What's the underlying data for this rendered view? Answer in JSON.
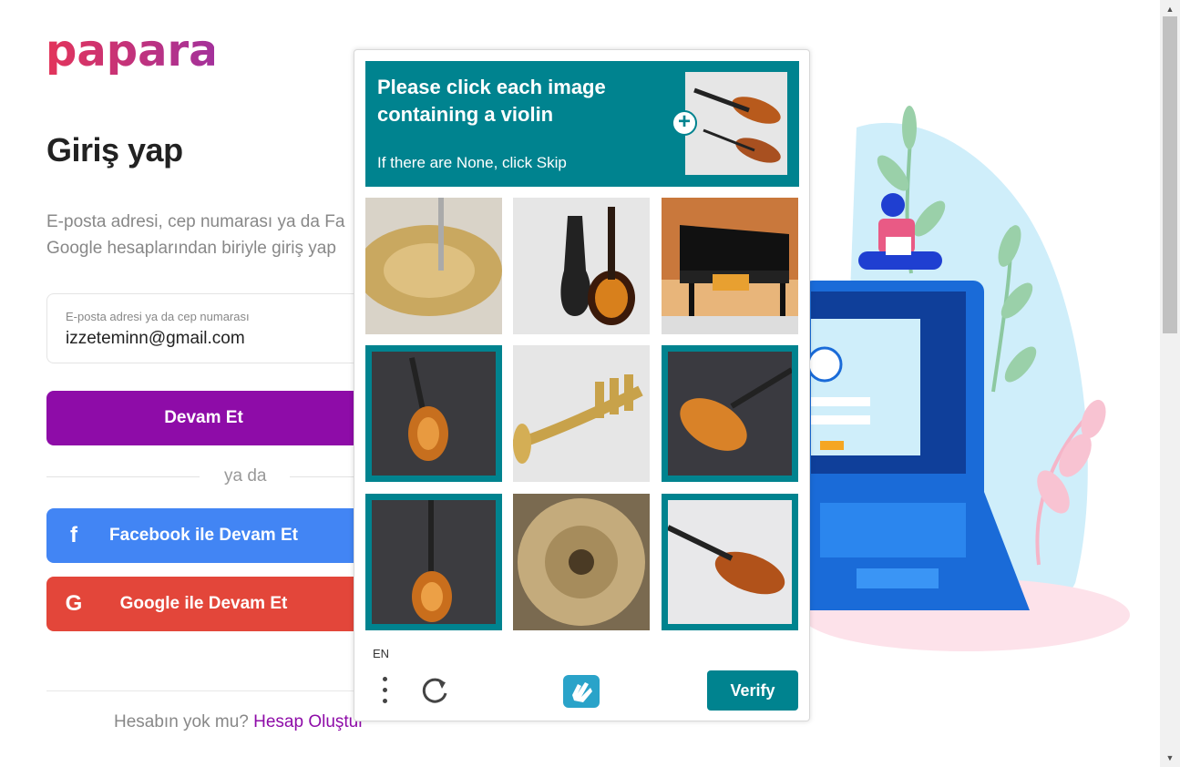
{
  "brand": {
    "name": "papara",
    "color": "#8e0ca8",
    "accent": "#e3345a"
  },
  "login": {
    "title": "Giriş yap",
    "description_line1": "E-posta adresi, cep numarası ya da Fa",
    "description_line2": "Google hesaplarından biriyle giriş yap",
    "email_label": "E-posta adresi ya da cep numarası",
    "email_value": "izzeteminn@gmail.com",
    "continue_label": "Devam Et",
    "or_label": "ya da",
    "facebook_label": "Facebook ile Devam Et",
    "google_label": "Google ile Devam Et",
    "no_account_text": "Hesabın yok mu?",
    "create_account_link": "Hesap Oluştur"
  },
  "captcha": {
    "prompt": "Please click each image containing a violin",
    "sub_prompt": "If there are None, click Skip",
    "language": "EN",
    "verify_label": "Verify",
    "accent": "#00838f",
    "tiles": [
      {
        "subject": "cymbal",
        "selected": false
      },
      {
        "subject": "guitars",
        "selected": false
      },
      {
        "subject": "piano",
        "selected": false
      },
      {
        "subject": "violin",
        "selected": true
      },
      {
        "subject": "trumpet",
        "selected": false
      },
      {
        "subject": "violin",
        "selected": true
      },
      {
        "subject": "violin",
        "selected": true
      },
      {
        "subject": "cymbal",
        "selected": false
      },
      {
        "subject": "violin",
        "selected": true
      }
    ]
  },
  "icons": {
    "facebook": "facebook-icon",
    "google": "google-icon",
    "menu": "more-vertical-icon",
    "refresh": "refresh-icon",
    "hcaptcha": "hcaptcha-logo-icon",
    "plus": "plus-icon"
  }
}
